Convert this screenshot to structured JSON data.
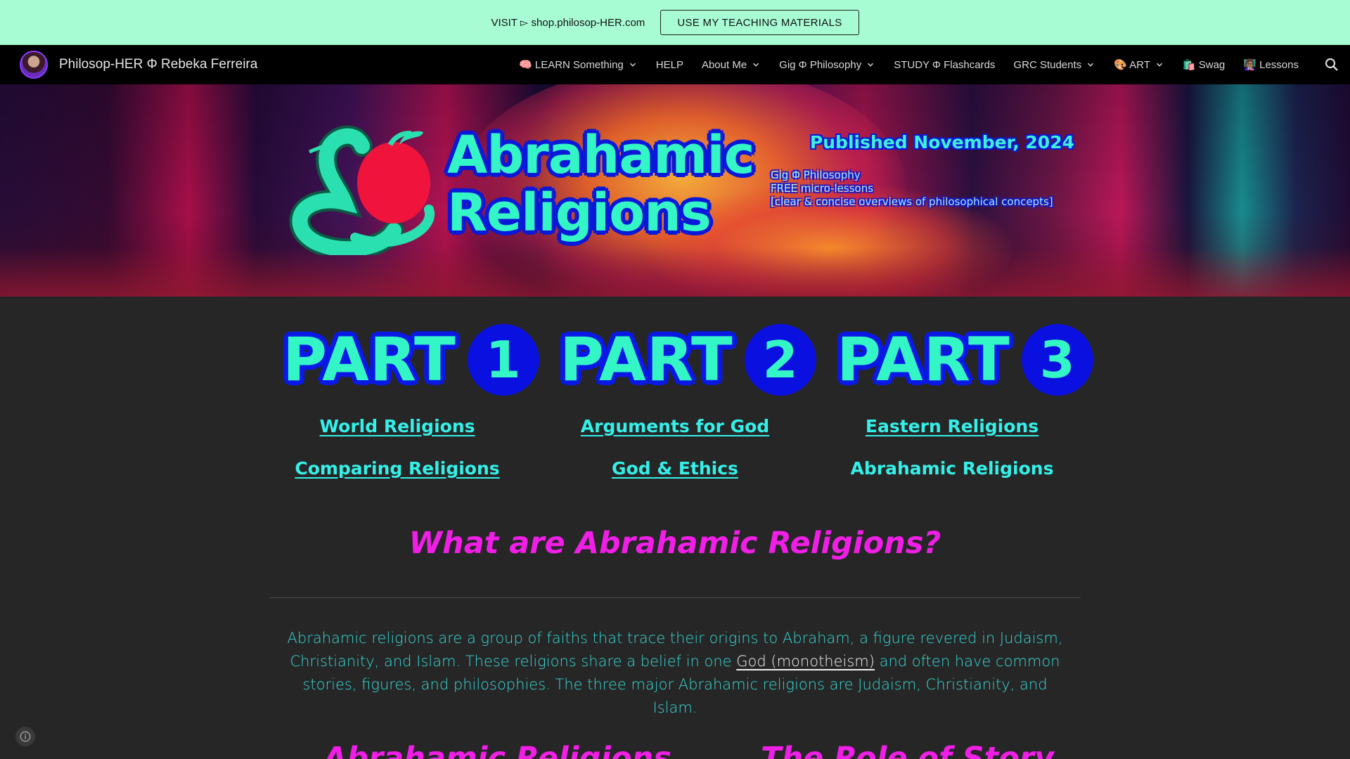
{
  "announcement": {
    "text": "VISIT ▻ shop.philosop-HER.com",
    "button_label": "USE MY TEACHING MATERIALS"
  },
  "header": {
    "site_title": "Philosop-HER Φ Rebeka Ferreira",
    "nav": [
      {
        "label": "🧠 LEARN Something",
        "dropdown": true
      },
      {
        "label": "HELP",
        "dropdown": false
      },
      {
        "label": "About Me",
        "dropdown": true
      },
      {
        "label": "Gig Φ Philosophy",
        "dropdown": true
      },
      {
        "label": "STUDY Φ Flashcards",
        "dropdown": false
      },
      {
        "label": "GRC Students",
        "dropdown": true
      },
      {
        "label": "🎨 ART",
        "dropdown": true
      },
      {
        "label": "🛍️ Swag",
        "dropdown": false
      },
      {
        "label": "👩🏽‍🏫 Lessons",
        "dropdown": false
      }
    ]
  },
  "hero": {
    "title_line1": "Abrahamic",
    "title_line2": "Religions",
    "published": "Published November, 2024",
    "sub_line1": "Gig Φ Philosophy",
    "sub_line2": "FREE micro-lessons",
    "sub_line3": "[clear & concise overviews of philosophical concepts]"
  },
  "parts": [
    {
      "word": "PART",
      "number": "1",
      "links": [
        "World Religions",
        "Comparing Religions"
      ]
    },
    {
      "word": "PART",
      "number": "2",
      "links": [
        "Arguments for God",
        "God & Ethics"
      ]
    },
    {
      "word": "PART",
      "number": "3",
      "links": [
        "Eastern Religions",
        "Abrahamic Religions"
      ]
    }
  ],
  "main": {
    "question": "What are Abrahamic Religions?",
    "paragraph_before": "Abrahamic religions are a group of faiths that trace their origins to Abraham, a figure revered in Judaism, Christianity, and Islam. These religions share a belief in one ",
    "paragraph_link": "God (monotheism)",
    "paragraph_after": " and often have common stories, figures, and philosophies. The three major Abrahamic religions are Judaism, Christianity, and Islam.",
    "subheading_left": "Abrahamic Religions",
    "subheading_right": "The Role of Story"
  },
  "colors": {
    "announcement_bg": "#a8fcd4",
    "accent_teal": "#34f5c5",
    "accent_blue": "#0a10e0",
    "accent_magenta": "#f01ee6",
    "page_bg": "#262626"
  },
  "icons": [
    "search-icon",
    "chevron-down-icon",
    "info-icon",
    "snake-apple-logo"
  ]
}
